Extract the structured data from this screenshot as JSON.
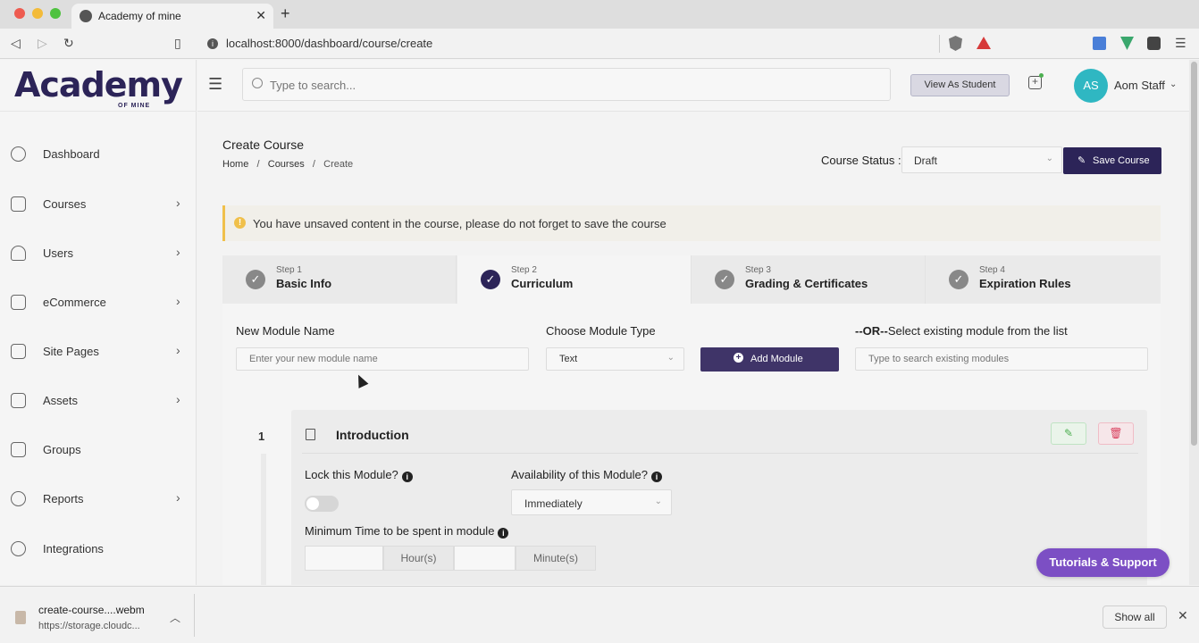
{
  "browser": {
    "tab_title": "Academy of mine",
    "url": "localhost:8000/dashboard/course/create"
  },
  "brand": {
    "logo_text": "Academy",
    "logo_sub": "OF MINE",
    "primary_color": "#2c2458",
    "accent_color": "#7c4fc4"
  },
  "sidebar": {
    "items": [
      {
        "label": "Dashboard",
        "icon": "dashboard-icon",
        "has_children": false
      },
      {
        "label": "Courses",
        "icon": "book-icon",
        "has_children": true
      },
      {
        "label": "Users",
        "icon": "user-icon",
        "has_children": true
      },
      {
        "label": "eCommerce",
        "icon": "cart-icon",
        "has_children": true
      },
      {
        "label": "Site Pages",
        "icon": "pages-icon",
        "has_children": true
      },
      {
        "label": "Assets",
        "icon": "archive-icon",
        "has_children": true
      },
      {
        "label": "Groups",
        "icon": "building-icon",
        "has_children": false
      },
      {
        "label": "Reports",
        "icon": "pie-chart-icon",
        "has_children": true
      },
      {
        "label": "Integrations",
        "icon": "integrations-icon",
        "has_children": false
      }
    ]
  },
  "header": {
    "search_placeholder": "Type to search...",
    "view_as_student": "View As Student",
    "avatar_initials": "AS",
    "user_name": "Aom Staff"
  },
  "page": {
    "title": "Create Course",
    "breadcrumb": [
      "Home",
      "Courses",
      "Create"
    ],
    "course_status_label": "Course Status :",
    "course_status_value": "Draft",
    "save_label": "Save Course",
    "alert_text": "You have unsaved content in the course, please do not forget to save the course"
  },
  "steps": [
    {
      "num": "Step 1",
      "name": "Basic Info",
      "active": false
    },
    {
      "num": "Step 2",
      "name": "Curriculum",
      "active": true
    },
    {
      "num": "Step 3",
      "name": "Grading & Certificates",
      "active": false
    },
    {
      "num": "Step 4",
      "name": "Expiration Rules",
      "active": false
    }
  ],
  "curriculum": {
    "new_module_label": "New Module Name",
    "new_module_placeholder": "Enter your new module name",
    "module_type_label": "Choose Module Type",
    "module_type_value": "Text",
    "add_module_label": "Add Module",
    "existing_label_prefix": "--OR--",
    "existing_label_rest": "Select existing module from the list",
    "existing_placeholder": "Type to search existing modules"
  },
  "module": {
    "number": "1",
    "title": "Introduction",
    "lock_label": "Lock this Module?",
    "availability_label": "Availability of this Module?",
    "availability_value": "Immediately",
    "min_time_label": "Minimum Time to be spent in module",
    "hours_label": "Hour(s)",
    "minutes_label": "Minute(s)"
  },
  "support": {
    "label": "Tutorials & Support"
  },
  "downloads": {
    "file_name": "create-course....webm",
    "file_url": "https://storage.cloudc...",
    "show_all": "Show all"
  }
}
